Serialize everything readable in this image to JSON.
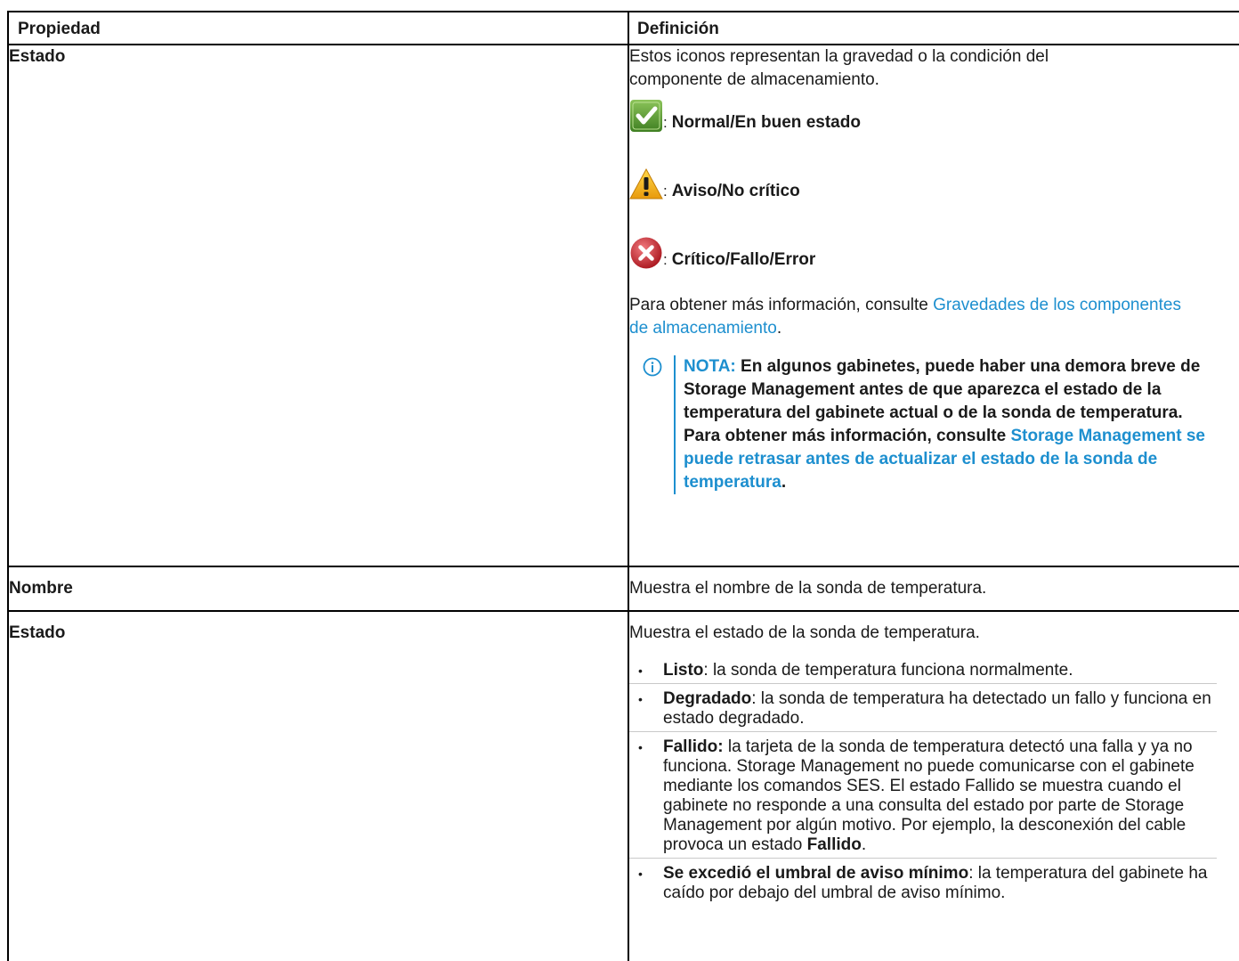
{
  "table": {
    "header": {
      "property": "Propiedad",
      "definition": "Definición"
    },
    "rows": [
      {
        "property": "Estado",
        "intro": "Estos iconos representan la gravedad o la condición del componente de almacenamiento.",
        "statuses": [
          {
            "icon": "check-icon",
            "label": "Normal/En buen estado",
            "color": "#5a9e2f"
          },
          {
            "icon": "warning-icon",
            "label": "Aviso/No crítico",
            "color": "#f2b01e"
          },
          {
            "icon": "error-icon",
            "label": "Crítico/Fallo/Error",
            "color": "#c4272f"
          }
        ],
        "separator": ":",
        "more_info_text": "Para obtener más información, consulte ",
        "more_info_link": "Gravedades de los componentes de almacenamiento",
        "more_info_end": ".",
        "note": {
          "label": "NOTA:",
          "text": " En algunos gabinetes, puede haber una demora breve de Storage Management antes de que aparezca el estado de la temperatura del gabinete actual o de la sonda de temperatura. Para obtener más información, consulte ",
          "link": "Storage Management se puede retrasar antes de actualizar el estado de la sonda de temperatura",
          "end": "."
        }
      },
      {
        "property": "Nombre",
        "definition": "Muestra el nombre de la sonda de temperatura."
      },
      {
        "property": "Estado",
        "intro": "Muestra el estado de la sonda de temperatura.",
        "items": [
          {
            "term": "Listo",
            "text": ": la sonda de temperatura funciona normalmente."
          },
          {
            "term": "Degradado",
            "text": ": la sonda de temperatura ha detectado un fallo y funciona en estado degradado."
          },
          {
            "term": "Fallido:",
            "text": " la tarjeta de la sonda de temperatura detectó una falla y ya no funciona. Storage Management no puede comunicarse con el gabinete mediante los comandos SES. El estado Fallido se muestra cuando el gabinete no responde a una consulta del estado por parte de Storage Management por algún motivo. Por ejemplo, la desconexión del cable provoca un estado ",
            "term2": "Fallido",
            "text2": "."
          },
          {
            "term": "Se excedió el umbral de aviso mínimo",
            "text": ": la temperatura del gabinete ha caído por debajo del umbral de aviso mínimo."
          }
        ],
        "bullet": "•"
      }
    ]
  },
  "colors": {
    "link": "#1d8fcf",
    "border": "#000000"
  }
}
